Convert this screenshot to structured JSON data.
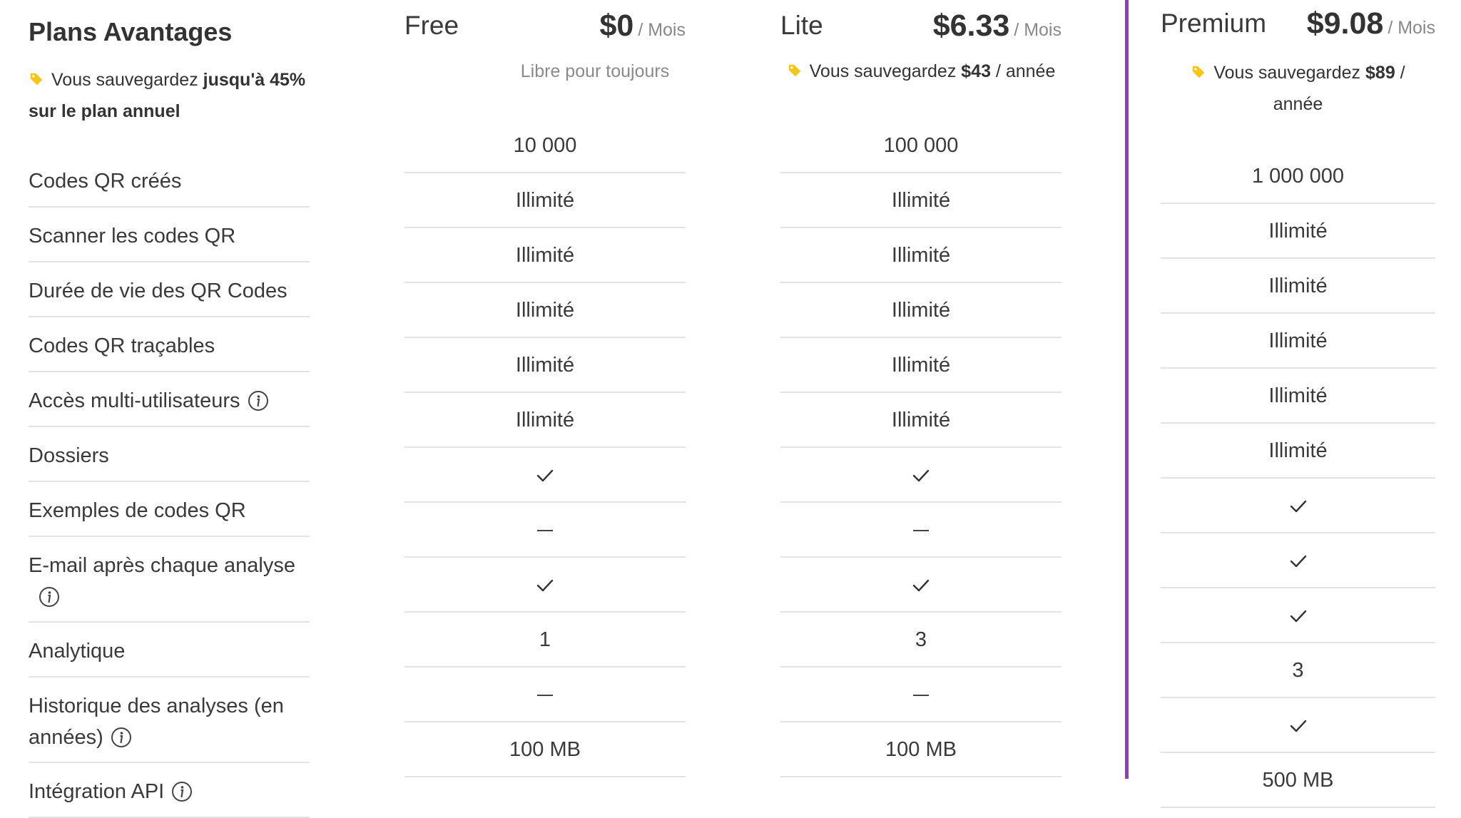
{
  "benefits": {
    "title": "Plans Avantages",
    "savings_prefix": "Vous sauvegardez ",
    "savings_bold": "jusqu'à 45% sur le plan annuel",
    "features": [
      "Codes QR créés",
      "Scanner les codes QR",
      "Durée de vie des QR Codes",
      "Codes QR traçables",
      "Accès multi-utilisateurs",
      "Dossiers",
      "Exemples de codes QR",
      "E-mail après chaque analyse",
      "Analytique",
      "Historique des analyses (en années)",
      "Intégration API"
    ]
  },
  "plans": {
    "free": {
      "name": "Free",
      "price": "$0",
      "period": "/ Mois",
      "note": "Libre pour toujours",
      "values": [
        "10 000",
        "Illimité",
        "Illimité",
        "Illimité",
        "Illimité",
        "Illimité",
        "check",
        "dash",
        "check",
        "1",
        "dash",
        "100 MB"
      ]
    },
    "lite": {
      "name": "Lite",
      "price": "$6.33",
      "period": "/ Mois",
      "note_prefix": "Vous sauvegardez ",
      "note_bold": "$43",
      "note_suffix": " / année",
      "values": [
        "100 000",
        "Illimité",
        "Illimité",
        "Illimité",
        "Illimité",
        "Illimité",
        "check",
        "dash",
        "check",
        "3",
        "dash",
        "100 MB"
      ]
    },
    "premium": {
      "name": "Premium",
      "price": "$9.08",
      "period": "/ Mois",
      "note_prefix": "Vous sauvegardez ",
      "note_bold": "$89",
      "note_suffix": " / année",
      "values": [
        "1 000 000",
        "Illimité",
        "Illimité",
        "Illimité",
        "Illimité",
        "Illimité",
        "check",
        "check",
        "check",
        "3",
        "check",
        "500 MB"
      ]
    }
  },
  "colors": {
    "accent": "#8e3fb3",
    "tag": "#f5c518",
    "divider": "#e3e3e3"
  },
  "icons": {
    "tag": "tag-icon",
    "info": "info-icon",
    "check": "check-icon",
    "dash": "dash-icon"
  }
}
